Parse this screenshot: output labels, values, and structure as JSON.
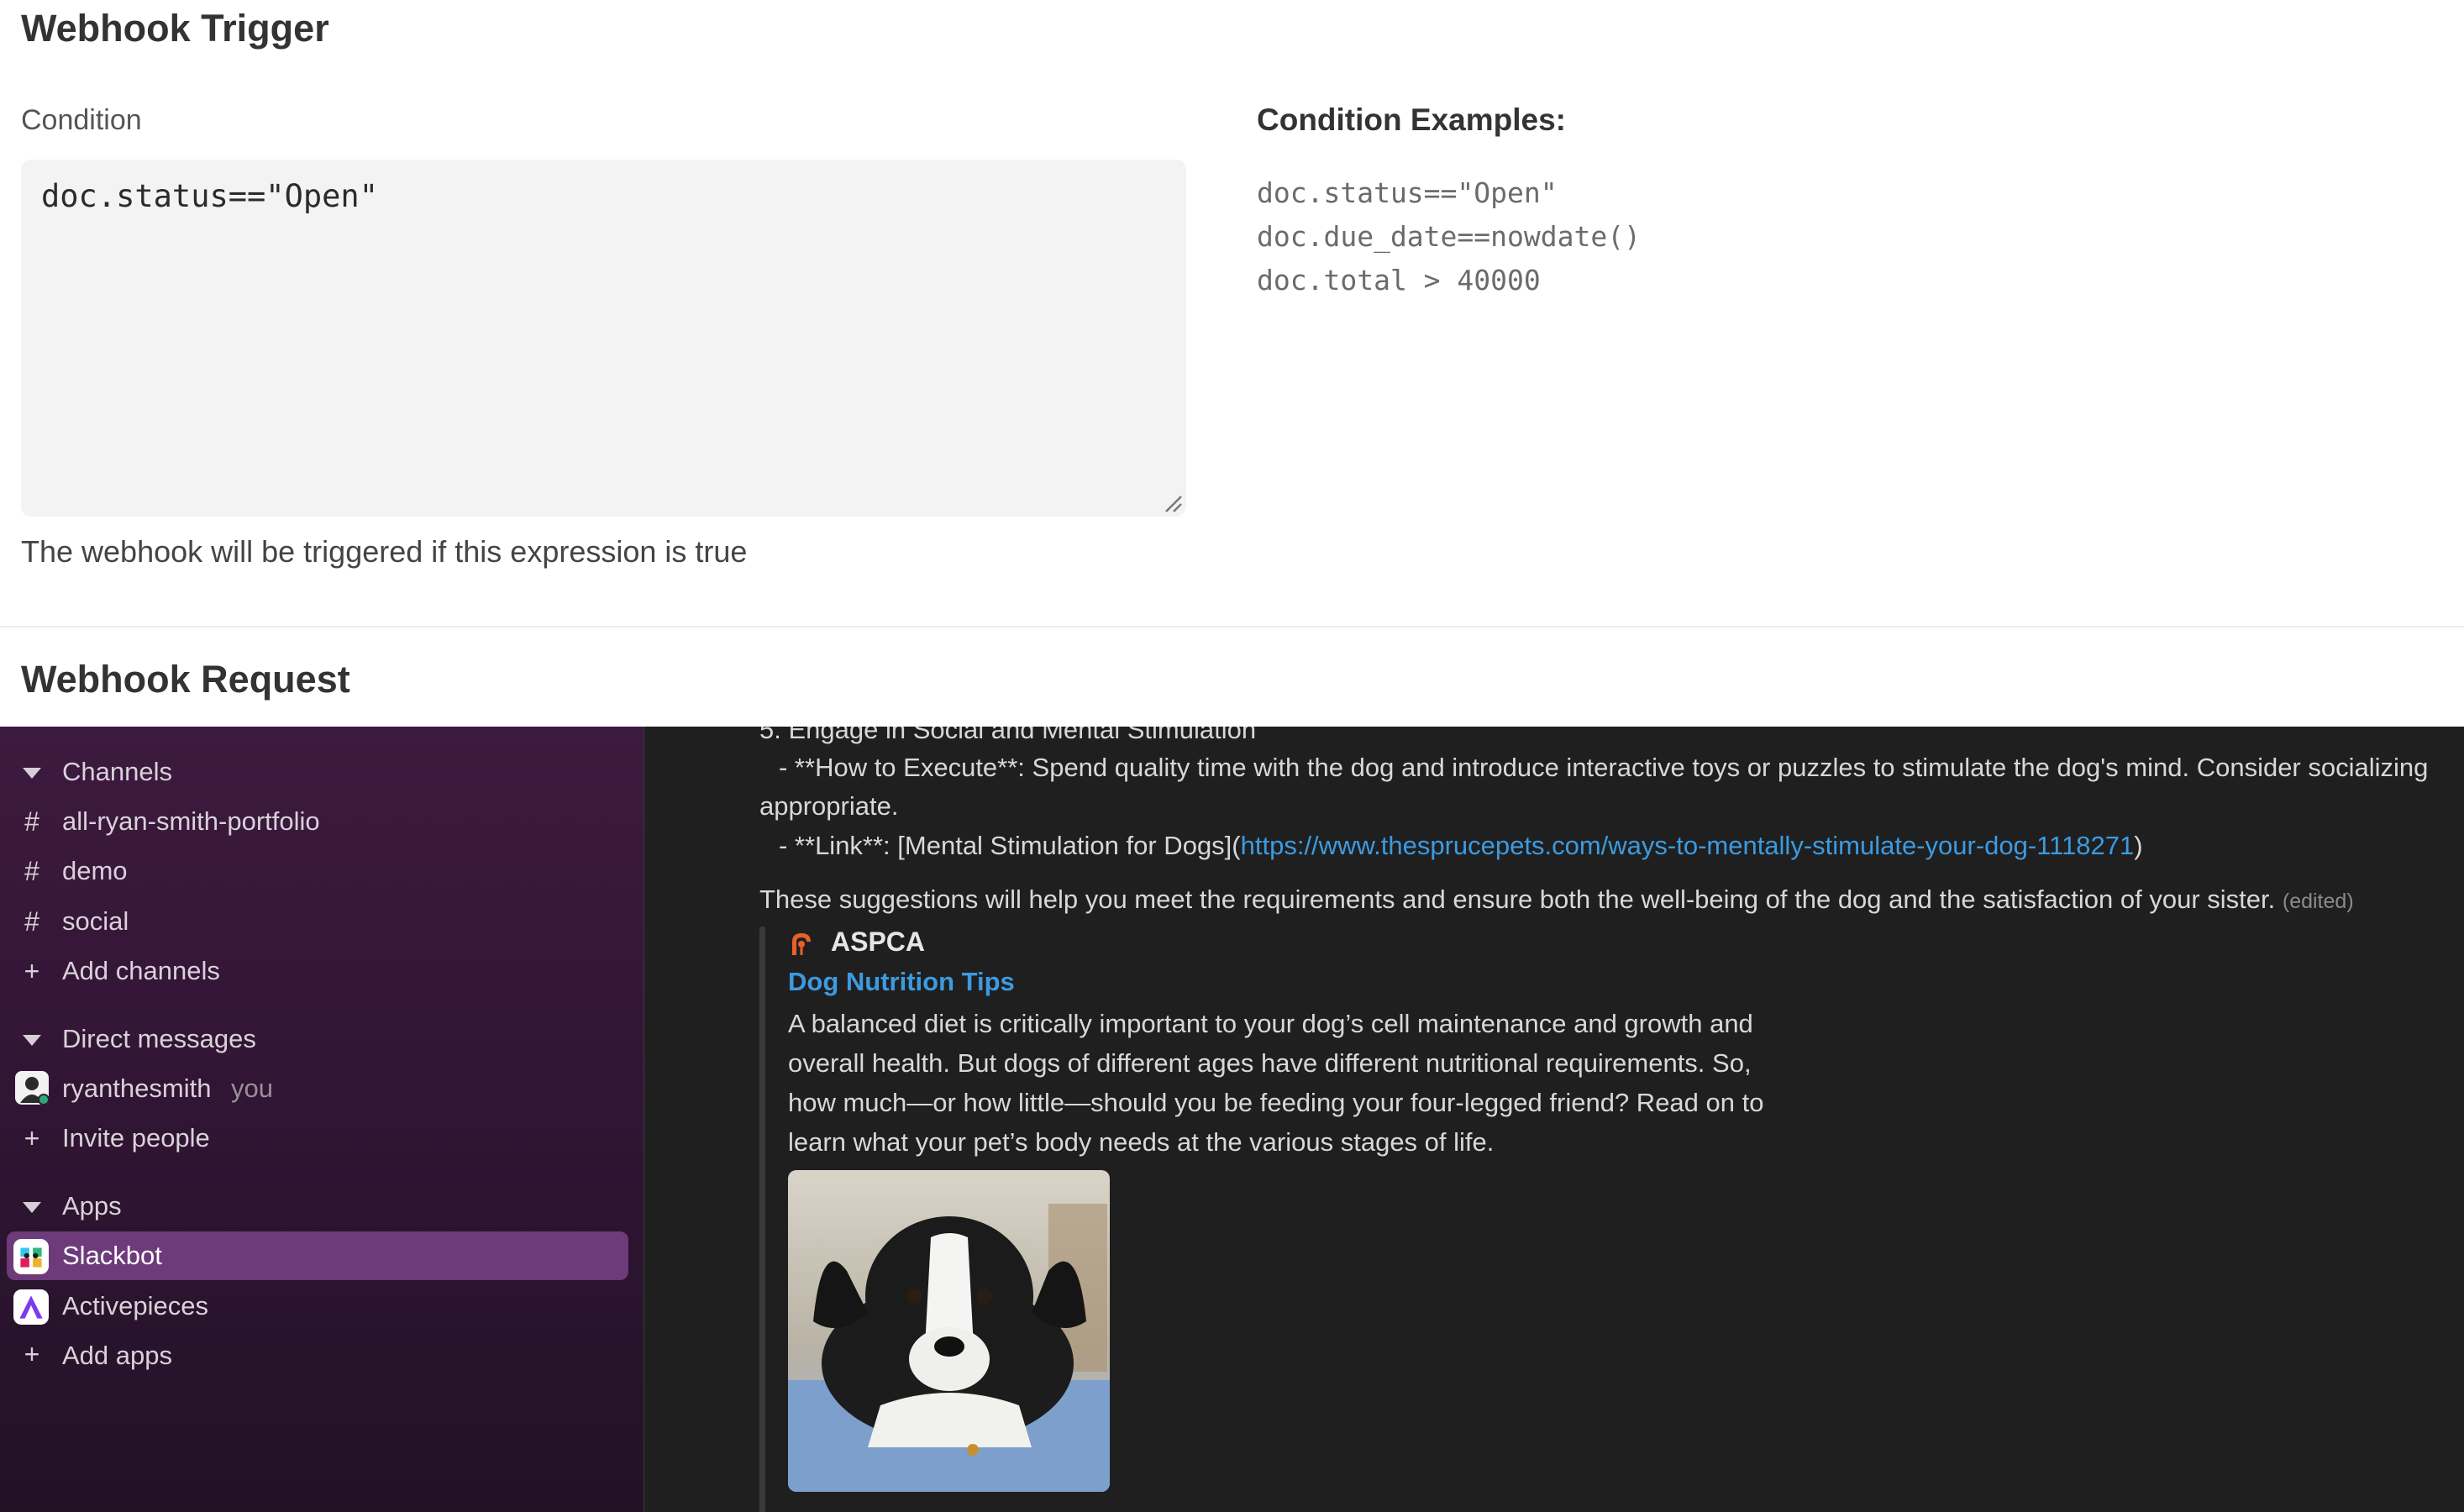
{
  "trigger": {
    "title": "Webhook Trigger",
    "condition_label": "Condition",
    "condition_value": "doc.status==\"Open\"",
    "helper_text": "The webhook will be triggered if this expression is true",
    "examples_title": "Condition Examples:",
    "examples": [
      "doc.status==\"Open\"",
      "doc.due_date==nowdate()",
      "doc.total > 40000"
    ]
  },
  "request": {
    "title": "Webhook Request"
  },
  "sidebar": {
    "channels_header": "Channels",
    "channels": [
      {
        "label": "all-ryan-smith-portfolio",
        "icon": "hash-icon"
      },
      {
        "label": "demo",
        "icon": "hash-icon"
      },
      {
        "label": "social",
        "icon": "hash-icon"
      }
    ],
    "add_channels": "Add channels",
    "dm_header": "Direct messages",
    "dm_user": "ryanthesmith",
    "dm_you": "you",
    "invite_people": "Invite people",
    "apps_header": "Apps",
    "apps": [
      {
        "label": "Slackbot",
        "icon": "slackbot-icon",
        "active": true
      },
      {
        "label": "Activepieces",
        "icon": "activepieces-icon",
        "active": false
      }
    ],
    "add_apps": "Add apps",
    "active_color": "#6d3a7a"
  },
  "chat": {
    "cut_off_line": "5.   Engage in Social and Mental Stimulation",
    "execute_line": "- **How to Execute**: Spend quality time with the dog and introduce interactive toys or puzzles to stimulate the dog's mind. Consider socializing",
    "execute_cont": "appropriate.",
    "link_prefix": "- **Link**: [Mental Stimulation for Dogs](",
    "link_url": "https://www.thesprucepets.com/ways-to-mentally-stimulate-your-dog-1118271",
    "link_suffix": ")",
    "summary": "These suggestions will help you meet the requirements and ensure both the well-being of the dog and the satisfaction of your sister.",
    "edited": "(edited)",
    "unfurl": {
      "source": "ASPCA",
      "title": "Dog Nutrition Tips",
      "description": "A balanced diet is critically important to your dog’s cell maintenance and growth and overall health. But dogs of different ages have different nutritional requirements. So, how much—or how little—should you be feeding your four-legged friend? Read on to learn what your pet’s body needs at the various stages of life."
    },
    "link_color": "#3c9be0"
  }
}
